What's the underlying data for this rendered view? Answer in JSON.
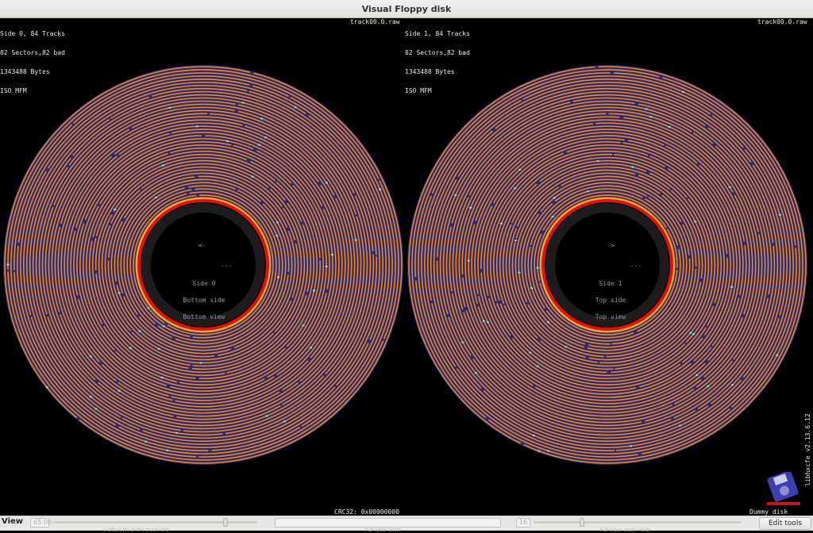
{
  "window": {
    "title": "Visual Floppy disk"
  },
  "side0": {
    "info_lines": [
      "Side 0, 84 Tracks",
      "82 Sectors,82 bad",
      "1343488 Bytes",
      "ISO MFM"
    ],
    "filename": "track00.0.raw",
    "arrow": "<-",
    "center_lines": [
      "Side 0",
      "Bottom side",
      "Bottom view"
    ],
    "dash": "---"
  },
  "side1": {
    "info_lines": [
      "Side 1, 84 Tracks",
      "82 Sectors,82 bad",
      "1343488 Bytes",
      "ISO MFM"
    ],
    "filename": "track00.0.raw",
    "arrow": "->",
    "center_lines": [
      "Side 1",
      "Top side",
      "Top view"
    ],
    "dash": "---"
  },
  "crc": "CRC32: 0x00000000",
  "disk_name": "Dummy disk",
  "version": "libhxcfe v2.13.6.12",
  "colors": {
    "track": "#f08a24",
    "gap": "#2e2c70",
    "index_ring": "#e01010",
    "index_glow": "#f5a623",
    "hub": "#1c1c1c"
  },
  "statusbar": {
    "label": "View",
    "left_field": "65.00",
    "right_field": "16",
    "caption_left": "x offset (% of the track len)",
    "caption_mid": "Full x/bar scale",
    "caption_right": "Full x/bar scale mode",
    "edit_tools": "Edit tools"
  },
  "icons": [
    "floppy-logo-icon"
  ]
}
